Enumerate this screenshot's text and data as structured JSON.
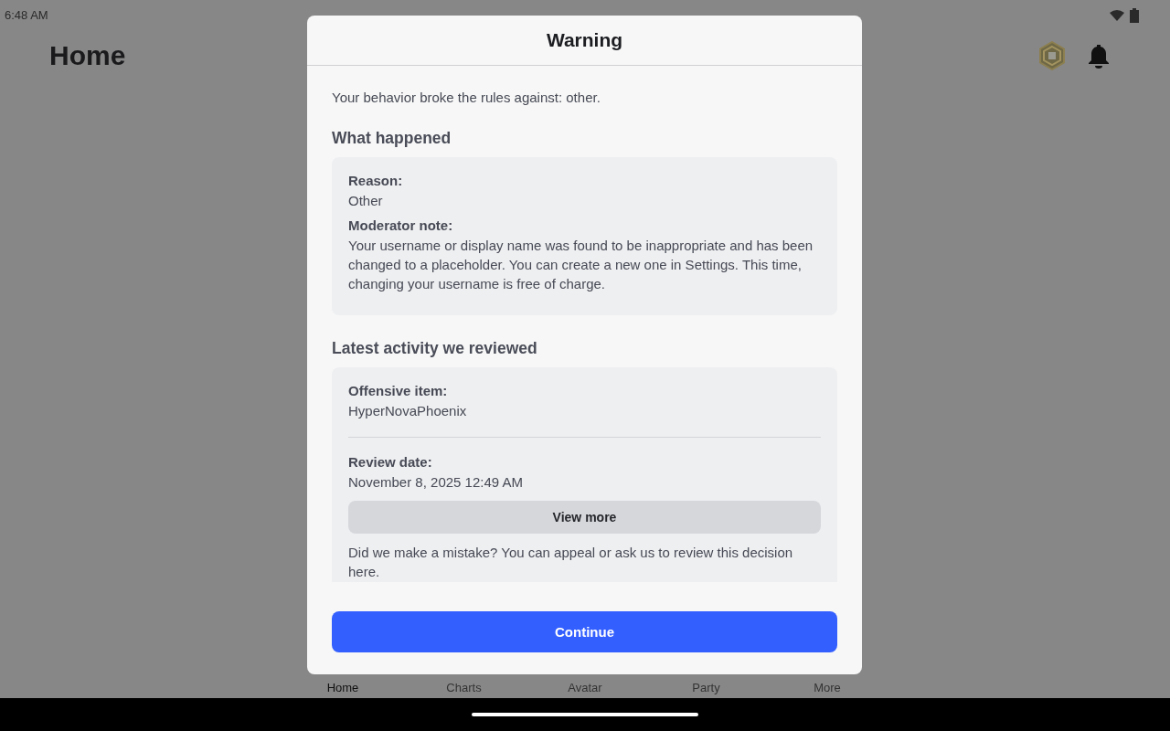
{
  "status_bar": {
    "time": "6:48 AM"
  },
  "header": {
    "title": "Home"
  },
  "bottom_nav": [
    {
      "label": "Home",
      "selected": true
    },
    {
      "label": "Charts",
      "selected": false
    },
    {
      "label": "Avatar",
      "selected": false
    },
    {
      "label": "Party",
      "selected": false
    },
    {
      "label": "More",
      "selected": false
    }
  ],
  "dialog": {
    "title": "Warning",
    "intro": "Your behavior broke the rules against: other.",
    "sections": [
      {
        "heading": "What happened",
        "fields": [
          {
            "label": "Reason:",
            "value": "Other"
          },
          {
            "label": "Moderator note:",
            "value": "Your username or display name was found to be inappropriate and has been changed to a placeholder. You can create a new one in Settings. This time, changing your username is free of charge."
          }
        ]
      },
      {
        "heading": "Latest activity we reviewed",
        "fields": [
          {
            "label": "Offensive item:",
            "value": "HyperNovaPhoenix"
          },
          {
            "label": "Review date:",
            "value": "November 8, 2025 12:49 AM"
          }
        ],
        "button": "View more",
        "note": "Did we make a mistake? You can appeal or ask us to review this decision here."
      }
    ],
    "primary_button": "Continue"
  }
}
